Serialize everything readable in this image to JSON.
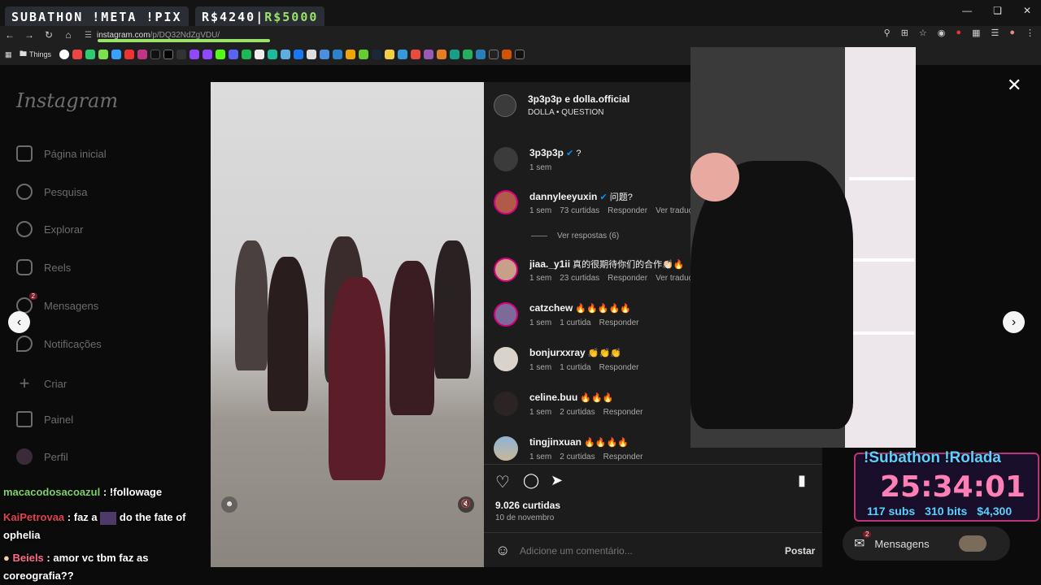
{
  "stream": {
    "banner_title": "SUBATHON !META !PIX",
    "goal_current": "R$4240",
    "goal_sep": "|",
    "goal_target": "R$5000"
  },
  "browser": {
    "url_prefix": "instagram.com",
    "url_path": "/p/DQ32NdZgVDU/",
    "bookmark_folder": "Things"
  },
  "sidebar": {
    "logo": "Instagram",
    "items": [
      {
        "label": "Página inicial",
        "icon": "home-icon"
      },
      {
        "label": "Pesquisa",
        "icon": "search-icon"
      },
      {
        "label": "Explorar",
        "icon": "compass-icon"
      },
      {
        "label": "Reels",
        "icon": "reels-icon"
      },
      {
        "label": "Mensagens",
        "icon": "messenger-icon",
        "badge": "2"
      },
      {
        "label": "Notificações",
        "icon": "heart-icon"
      },
      {
        "label": "Criar",
        "icon": "plus-icon"
      },
      {
        "label": "Painel",
        "icon": "chart-icon"
      },
      {
        "label": "Perfil",
        "icon": "avatar-icon"
      }
    ]
  },
  "post": {
    "authors": "3p3p3p e dolla.official",
    "audio": "DOLLA • QUESTION",
    "caption_user": "3p3p3p",
    "caption_text": "?",
    "caption_time": "1 sem",
    "likes": "9.026 curtidas",
    "date": "10 de novembro",
    "comment_placeholder": "Adicione um comentário...",
    "post_label": "Postar",
    "view_replies": "Ver respostas (6)"
  },
  "comments": [
    {
      "user": "dannyleeyuxin",
      "verified": true,
      "text": "问题?",
      "time": "1 sem",
      "likes": "73 curtidas",
      "reply": "Responder",
      "translate": "Ver tradução"
    },
    {
      "user": "jiaa._y1ii",
      "verified": false,
      "text": "真的很期待你们的合作👏🏻🔥",
      "time": "1 sem",
      "likes": "23 curtidas",
      "reply": "Responder",
      "translate": "Ver tradução"
    },
    {
      "user": "catzchew",
      "verified": false,
      "text": "🔥🔥🔥🔥🔥",
      "time": "1 sem",
      "likes": "1 curtida",
      "reply": "Responder",
      "translate": ""
    },
    {
      "user": "bonjurxxray",
      "verified": false,
      "text": "👏👏👏",
      "time": "1 sem",
      "likes": "1 curtida",
      "reply": "Responder",
      "translate": ""
    },
    {
      "user": "celine.buu",
      "verified": false,
      "text": "🔥🔥🔥",
      "time": "1 sem",
      "likes": "2 curtidas",
      "reply": "Responder",
      "translate": ""
    },
    {
      "user": "tingjinxuan",
      "verified": false,
      "text": "🔥🔥🔥🔥",
      "time": "1 sem",
      "likes": "2 curtidas",
      "reply": "Responder",
      "translate": ""
    }
  ],
  "chat": [
    {
      "user": "macacodosacoazul",
      "sep": ":",
      "msg": "!followage",
      "color": "#7cd36a"
    },
    {
      "user": "KaiPetrovaa",
      "sep": ":",
      "msg": "faz a",
      "msg2": "do the fate of ophelia",
      "color": "#e0434f"
    },
    {
      "user": "Beiels",
      "sep": ":",
      "msg": "amor vc tbm faz as coreografia??",
      "color": "#ff6b8b"
    }
  ],
  "subathon": {
    "title": "!Subathon !Rolada",
    "timer": "25:34:01",
    "subs": "117 subs",
    "bits": "310 bits",
    "money": "$4,300"
  },
  "dm_dock": {
    "label": "Mensagens",
    "badge": "2"
  },
  "colors": {
    "accent_green": "#9be26b",
    "ig_blue": "#0095f6",
    "sub_pink": "#ff7fb6",
    "sub_cyan": "#5ad1ff"
  }
}
